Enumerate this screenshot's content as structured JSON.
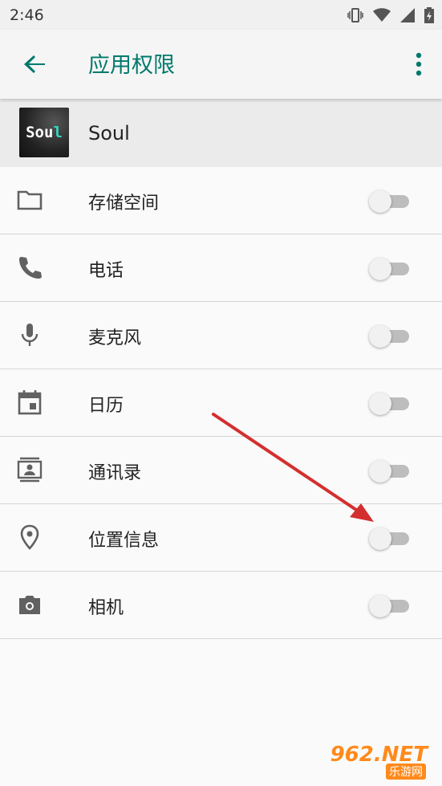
{
  "status_bar": {
    "time": "2:46"
  },
  "app_bar": {
    "title": "应用权限"
  },
  "app": {
    "name": "Soul",
    "logo_text": "Soul"
  },
  "permissions": [
    {
      "label": "存储空间",
      "icon": "folder-icon",
      "enabled": false
    },
    {
      "label": "电话",
      "icon": "phone-icon",
      "enabled": false
    },
    {
      "label": "麦克风",
      "icon": "microphone-icon",
      "enabled": false
    },
    {
      "label": "日历",
      "icon": "calendar-icon",
      "enabled": false
    },
    {
      "label": "通讯录",
      "icon": "contacts-icon",
      "enabled": false
    },
    {
      "label": "位置信息",
      "icon": "location-icon",
      "enabled": false
    },
    {
      "label": "相机",
      "icon": "camera-icon",
      "enabled": false
    }
  ],
  "watermark": {
    "text": "962.NET",
    "sub": "乐游网"
  },
  "colors": {
    "accent": "#00796b",
    "arrow": "#d32f2f"
  }
}
